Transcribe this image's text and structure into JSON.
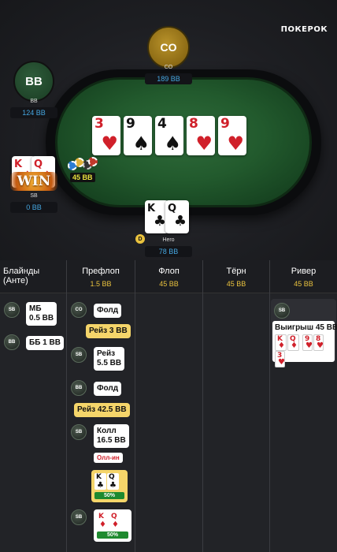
{
  "brand": "ПОКЕРОК",
  "seats": {
    "co": {
      "avatar": "CO",
      "name": "CO",
      "stack": "189 BB"
    },
    "bb": {
      "avatar": "BB",
      "name": "BB",
      "stack": "124 BB"
    },
    "sb": {
      "name": "SB",
      "stack": "0 BB",
      "win": "WIN",
      "cards": [
        {
          "rank": "K",
          "suit": "♦"
        },
        {
          "rank": "Q",
          "suit": "♦"
        }
      ]
    },
    "hero": {
      "name": "Hero",
      "stack": "78 BB",
      "dealer": "D",
      "cards": [
        {
          "rank": "K",
          "suit": "♣"
        },
        {
          "rank": "Q",
          "suit": "♣"
        }
      ]
    }
  },
  "pot_chips": "45 BB",
  "board": [
    {
      "rank": "3",
      "suit": "♥",
      "color": "red"
    },
    {
      "rank": "9",
      "suit": "♠",
      "color": "black"
    },
    {
      "rank": "4",
      "suit": "♠",
      "color": "black"
    },
    {
      "rank": "8",
      "suit": "♥",
      "color": "red"
    },
    {
      "rank": "9",
      "suit": "♥",
      "color": "red"
    }
  ],
  "columns": [
    {
      "title": "Блайнды (Анте)",
      "value": ""
    },
    {
      "title": "Префлоп",
      "value": "1.5 BB"
    },
    {
      "title": "Флоп",
      "value": "45 BB"
    },
    {
      "title": "Тёрн",
      "value": "45 BB"
    },
    {
      "title": "Ривер",
      "value": "45 BB"
    }
  ],
  "blinds": {
    "sb": {
      "badge": "SB",
      "text1": "МБ",
      "text2": "0.5 BB"
    },
    "bb": {
      "badge": "BB",
      "text": "ББ 1 BB"
    }
  },
  "preflop": {
    "co_badge": "CO",
    "co_action": "Фолд",
    "raise1": "Рейз 3 BB",
    "sb_badge1": "SB",
    "sb_action1a": "Рейз",
    "sb_action1b": "5.5 BB",
    "bb_badge": "BB",
    "bb_action": "Фолд",
    "raise2": "Рейз 42.5 BB",
    "sb_badge2": "SB",
    "sb_action2a": "Колл",
    "sb_action2b": "16.5 BB",
    "allin": "Олл-ин",
    "hero_hand_pct": "50%",
    "sb_badge3": "SB",
    "sb_hand_pct": "50%"
  },
  "river": {
    "badge": "SB",
    "win_text": "Выигрыш 45 BB",
    "cards": [
      {
        "rank": "K",
        "suit": "♦"
      },
      {
        "rank": "Q",
        "suit": "♦"
      },
      {
        "rank": "9",
        "suit": "♥"
      },
      {
        "rank": "8",
        "suit": "♥"
      },
      {
        "rank": "3",
        "suit": "♥"
      }
    ]
  }
}
